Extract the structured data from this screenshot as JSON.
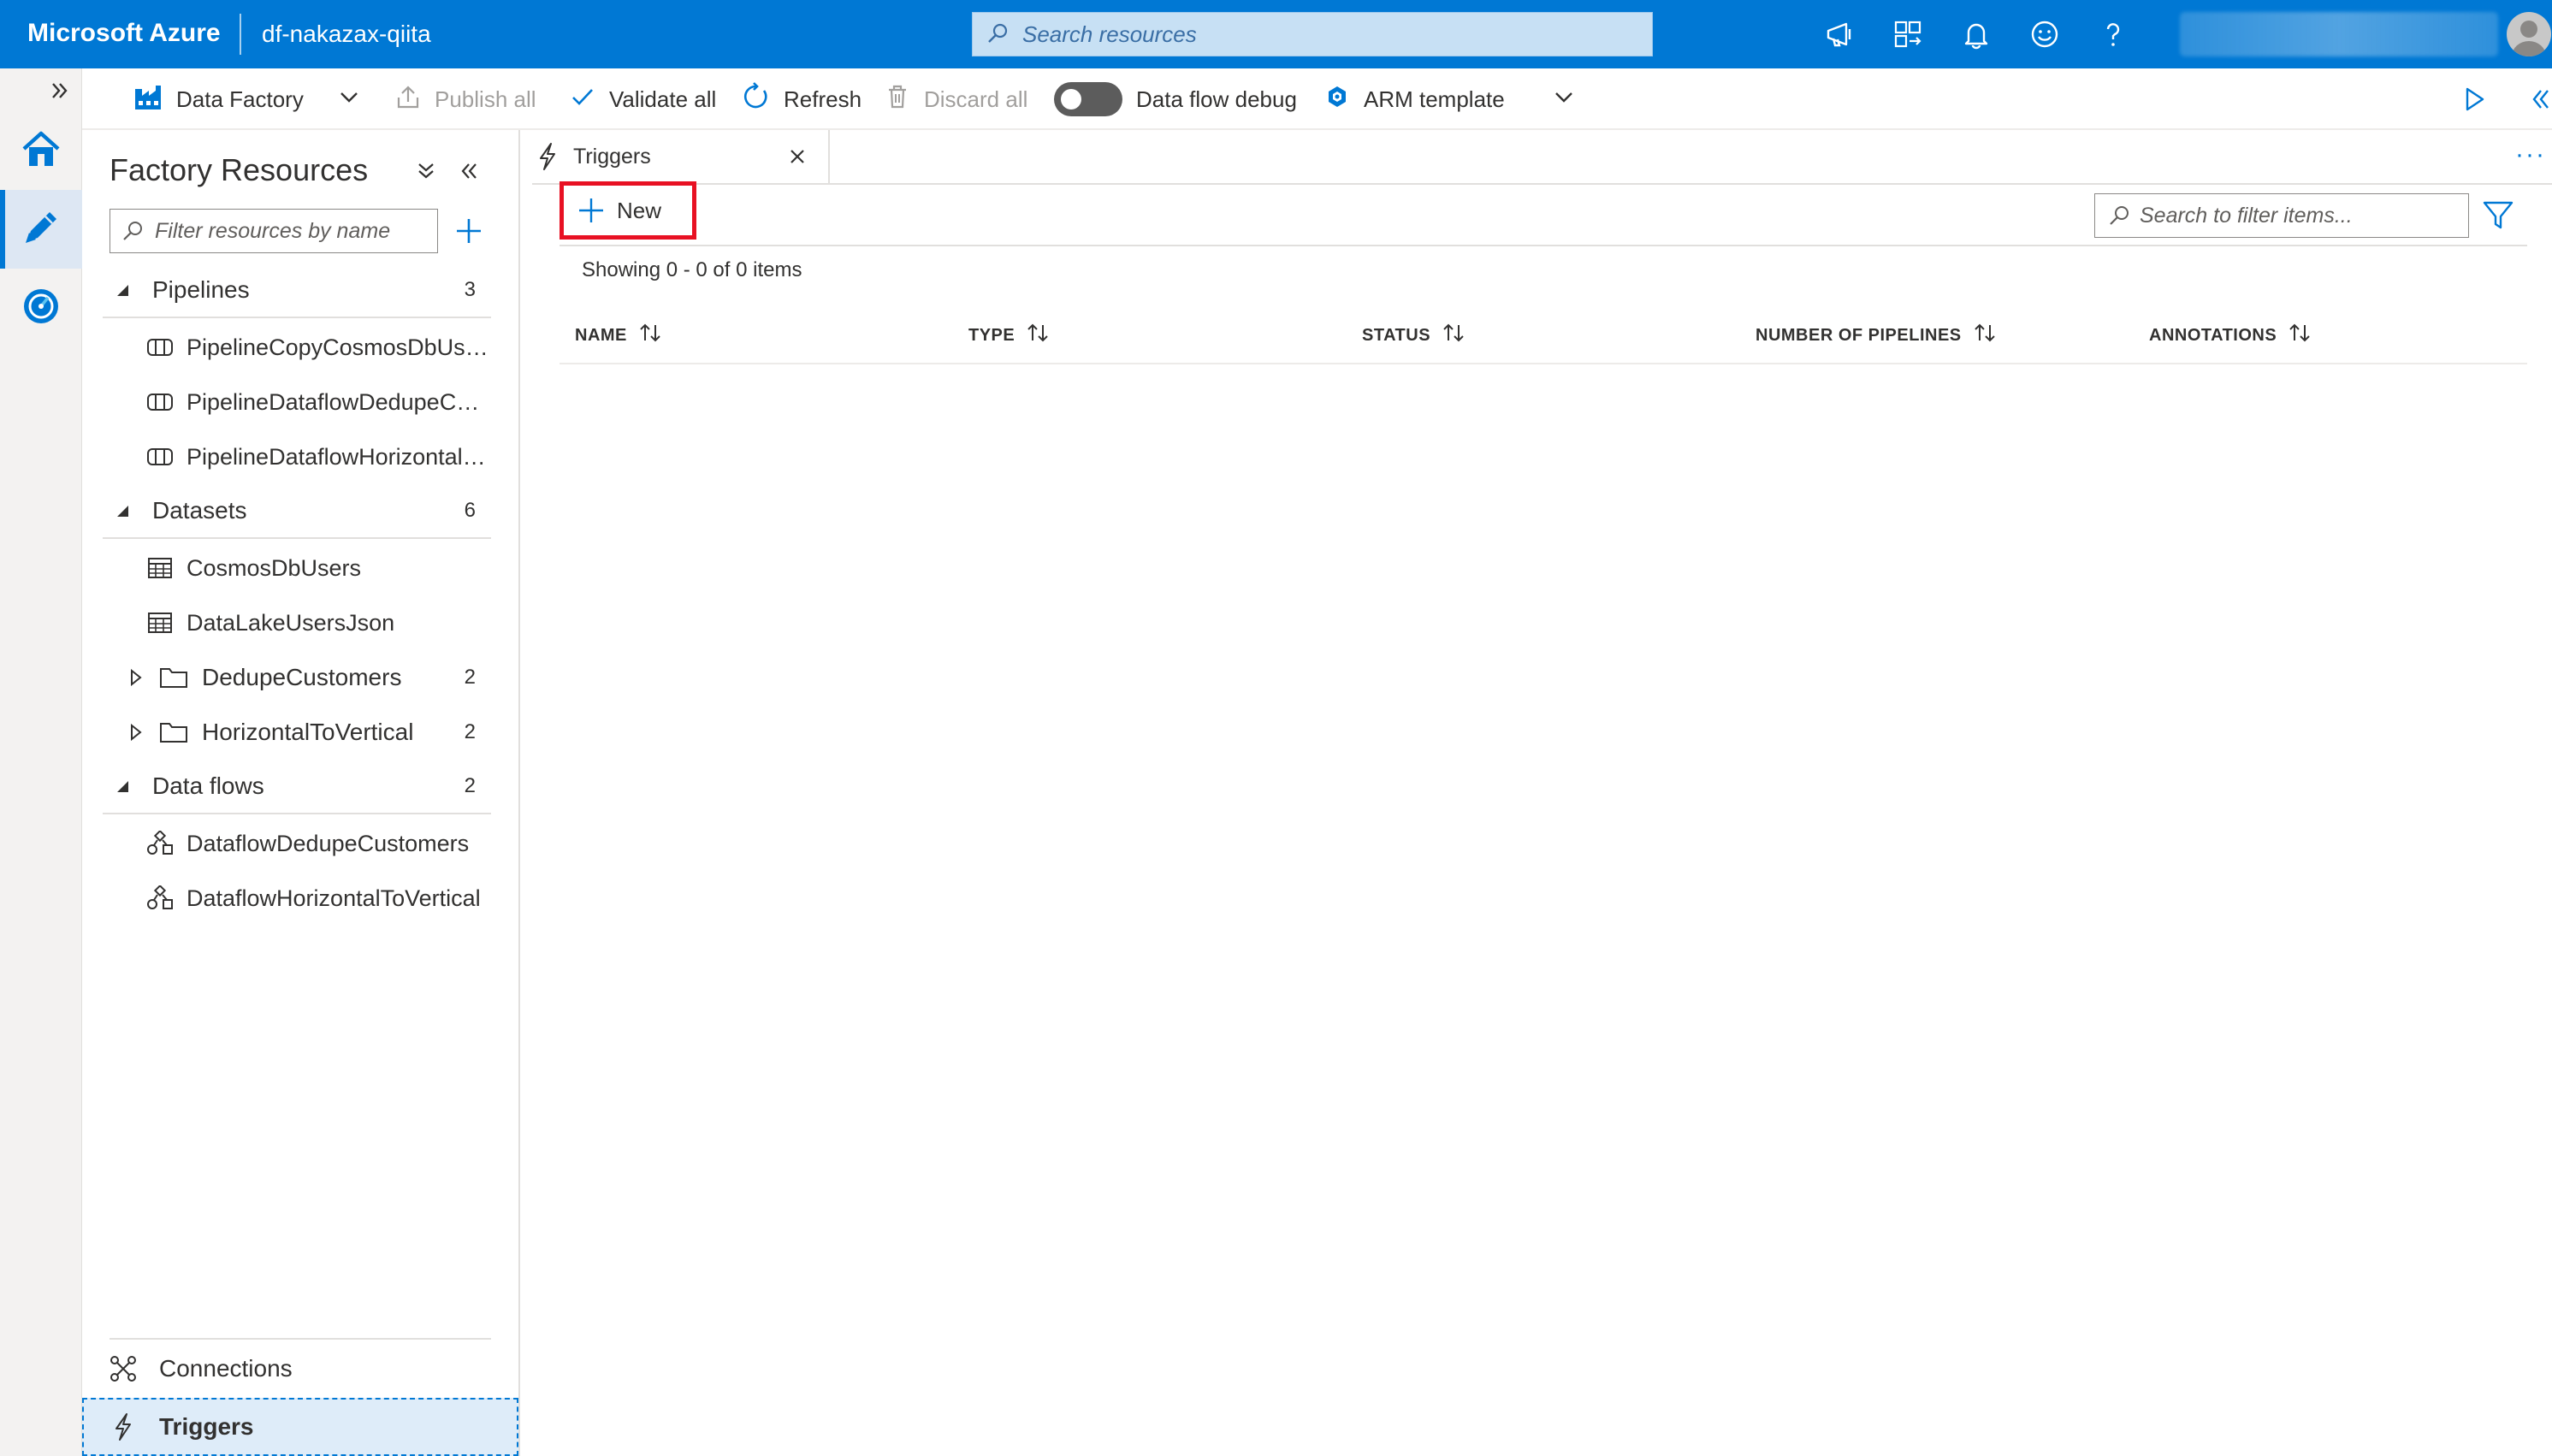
{
  "header": {
    "brand": "Microsoft Azure",
    "factory_name": "df-nakazax-qiita",
    "search_placeholder": "Search resources"
  },
  "toolbar": {
    "factory_label": "Data Factory",
    "publish_all": "Publish all",
    "validate_all": "Validate all",
    "refresh": "Refresh",
    "discard_all": "Discard all",
    "data_flow_debug": "Data flow debug",
    "arm_template": "ARM template"
  },
  "resources": {
    "title": "Factory Resources",
    "filter_placeholder": "Filter resources by name",
    "sections": {
      "pipelines": {
        "label": "Pipelines",
        "count": "3",
        "items": [
          "PipelineCopyCosmosDbUser...",
          "PipelineDataflowDedupeCus...",
          "PipelineDataflowHorizontalT..."
        ]
      },
      "datasets": {
        "label": "Datasets",
        "count": "6",
        "items": [
          "CosmosDbUsers",
          "DataLakeUsersJson"
        ],
        "folders": [
          {
            "label": "DedupeCustomers",
            "count": "2"
          },
          {
            "label": "HorizontalToVertical",
            "count": "2"
          }
        ]
      },
      "dataflows": {
        "label": "Data flows",
        "count": "2",
        "items": [
          "DataflowDedupeCustomers",
          "DataflowHorizontalToVertical"
        ]
      }
    },
    "footer": {
      "connections": "Connections",
      "triggers": "Triggers"
    }
  },
  "document": {
    "tab_label": "Triggers",
    "new_label": "New",
    "search_placeholder": "Search to filter items...",
    "showing": "Showing 0 - 0 of 0 items",
    "columns": [
      "NAME",
      "TYPE",
      "STATUS",
      "NUMBER OF PIPELINES",
      "ANNOTATIONS"
    ]
  },
  "colors": {
    "azure_blue": "#0078d4",
    "highlight_red": "#e81123",
    "rail_background": "#f3f2f1"
  }
}
